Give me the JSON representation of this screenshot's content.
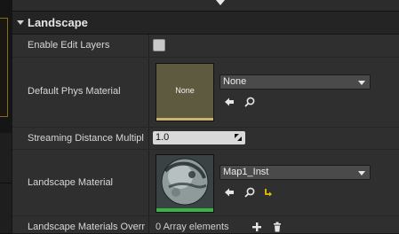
{
  "category": {
    "title": "Landscape"
  },
  "rows": {
    "enable_edit_layers": {
      "label": "Enable Edit Layers",
      "checked": false
    },
    "default_phys_material": {
      "label": "Default Phys Material",
      "thumbnail_text": "None",
      "value": "None"
    },
    "streaming_distance": {
      "label": "Streaming Distance Multipl",
      "value": "1.0"
    },
    "landscape_material": {
      "label": "Landscape Material",
      "value": "Map1_Inst"
    },
    "landscape_materials_override": {
      "label": "Landscape Materials Overr",
      "value": "0 Array elements"
    }
  },
  "colors": {
    "panel": "#2f2f2f",
    "category": "#242424",
    "accent_green": "#39b34a",
    "accent_yellow": "#c8b670",
    "reset_yellow": "#e6c200"
  },
  "icons": [
    "use-selected-arrow-icon",
    "browse-magnifier-icon",
    "reset-to-default-icon",
    "add-plus-icon",
    "delete-trash-icon",
    "dropdown-arrow-icon"
  ]
}
